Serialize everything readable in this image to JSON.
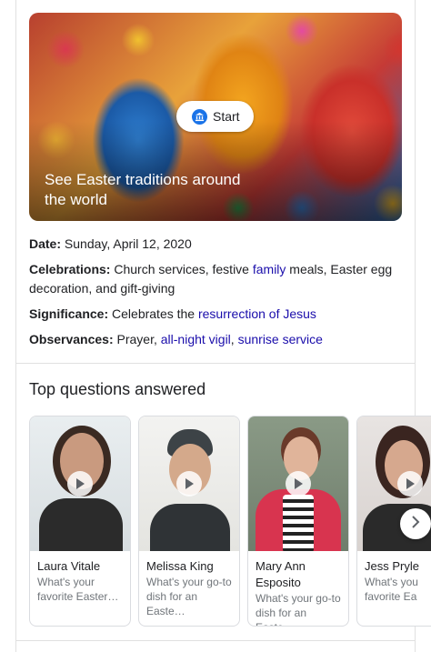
{
  "hero": {
    "start_label": "Start",
    "caption": "See Easter traditions around the world"
  },
  "facts": [
    {
      "label": "Date:",
      "parts": [
        {
          "t": " Sunday, April 12, 2020",
          "link": false
        }
      ]
    },
    {
      "label": "Celebrations:",
      "parts": [
        {
          "t": " Church services, festive ",
          "link": false
        },
        {
          "t": "family",
          "link": true
        },
        {
          "t": " meals, Easter egg decoration, and gift-giving",
          "link": false
        }
      ]
    },
    {
      "label": "Significance:",
      "parts": [
        {
          "t": " Celebrates the ",
          "link": false
        },
        {
          "t": "resurrection of Jesus",
          "link": true
        }
      ]
    },
    {
      "label": "Observances:",
      "parts": [
        {
          "t": " Prayer, ",
          "link": false
        },
        {
          "t": "all-night vigil",
          "link": true
        },
        {
          "t": ", ",
          "link": false
        },
        {
          "t": "sunrise service",
          "link": true
        }
      ]
    }
  ],
  "questions": {
    "title": "Top questions answered",
    "items": [
      {
        "name": "Laura Vitale",
        "question": "What's your favorite Easter…"
      },
      {
        "name": "Melissa King",
        "question": "What's your go-to dish for an Easte…"
      },
      {
        "name": "Mary Ann Esposito",
        "question": "What's your go-to dish for an Easte…"
      },
      {
        "name": "Jess Pryle",
        "question": "What's you favorite Ea"
      }
    ]
  },
  "colors": {
    "link": "#1a0dab",
    "accent": "#1a73e8"
  },
  "icons": {
    "start": "museum-icon",
    "play": "play-icon",
    "next": "chevron-right-icon"
  }
}
